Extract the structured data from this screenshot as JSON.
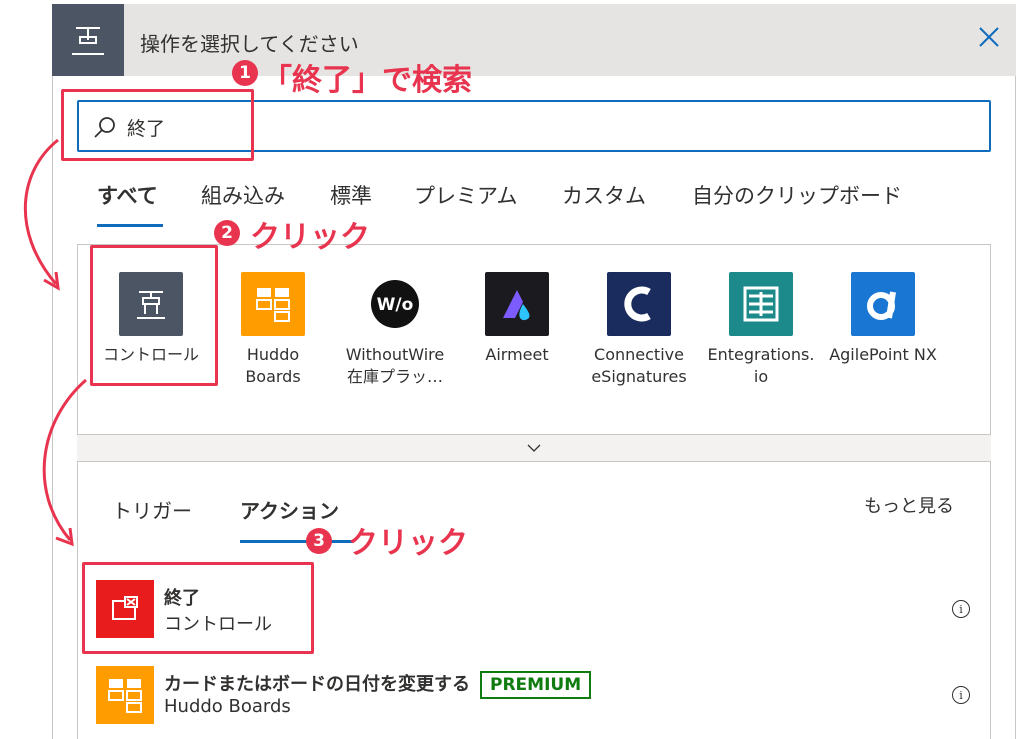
{
  "dialog": {
    "title": "操作を選択してください",
    "close_label": "×"
  },
  "search": {
    "value": "終了",
    "placeholder": ""
  },
  "tabs": [
    {
      "label": "すべて",
      "active": true
    },
    {
      "label": "組み込み",
      "active": false
    },
    {
      "label": "標準",
      "active": false
    },
    {
      "label": "プレミアム",
      "active": false
    },
    {
      "label": "カスタム",
      "active": false
    },
    {
      "label": "自分のクリップボード",
      "active": false
    }
  ],
  "connectors": [
    {
      "label": "コントロール",
      "icon": "control-icon",
      "color": "#4b5563"
    },
    {
      "label": "Huddo Boards",
      "icon": "huddo-boards-icon",
      "color": "#ff9c00"
    },
    {
      "label": "WithoutWire 在庫プラッ…",
      "icon": "withoutwire-icon",
      "color": "#ffffff"
    },
    {
      "label": "Airmeet",
      "icon": "airmeet-icon",
      "color": "#1b1b1f"
    },
    {
      "label": "Connective eSignatures",
      "icon": "connective-icon",
      "color": "#1a2b5e"
    },
    {
      "label": "Entegrations. io",
      "icon": "entegrations-icon",
      "color": "#1c8a8a"
    },
    {
      "label": "AgilePoint NX",
      "icon": "agilepoint-icon",
      "color": "#1976d2"
    }
  ],
  "subtabs": {
    "trigger": "トリガー",
    "action": "アクション",
    "see_more": "もっと見る"
  },
  "actions": [
    {
      "title": "終了",
      "subtitle": "コントロール",
      "icon": "terminate-icon",
      "color": "#e81c1c",
      "badge": ""
    },
    {
      "title": "カードまたはボードの日付を変更する",
      "subtitle": "Huddo Boards",
      "icon": "huddo-boards-icon",
      "color": "#ff9c00",
      "badge": "PREMIUM"
    }
  ],
  "annotations": {
    "step1_num": "1",
    "step1_text": "「終了」で検索",
    "step2_num": "2",
    "step2_text": "クリック",
    "step3_num": "3",
    "step3_text": "クリック",
    "color": "#e8344e"
  }
}
